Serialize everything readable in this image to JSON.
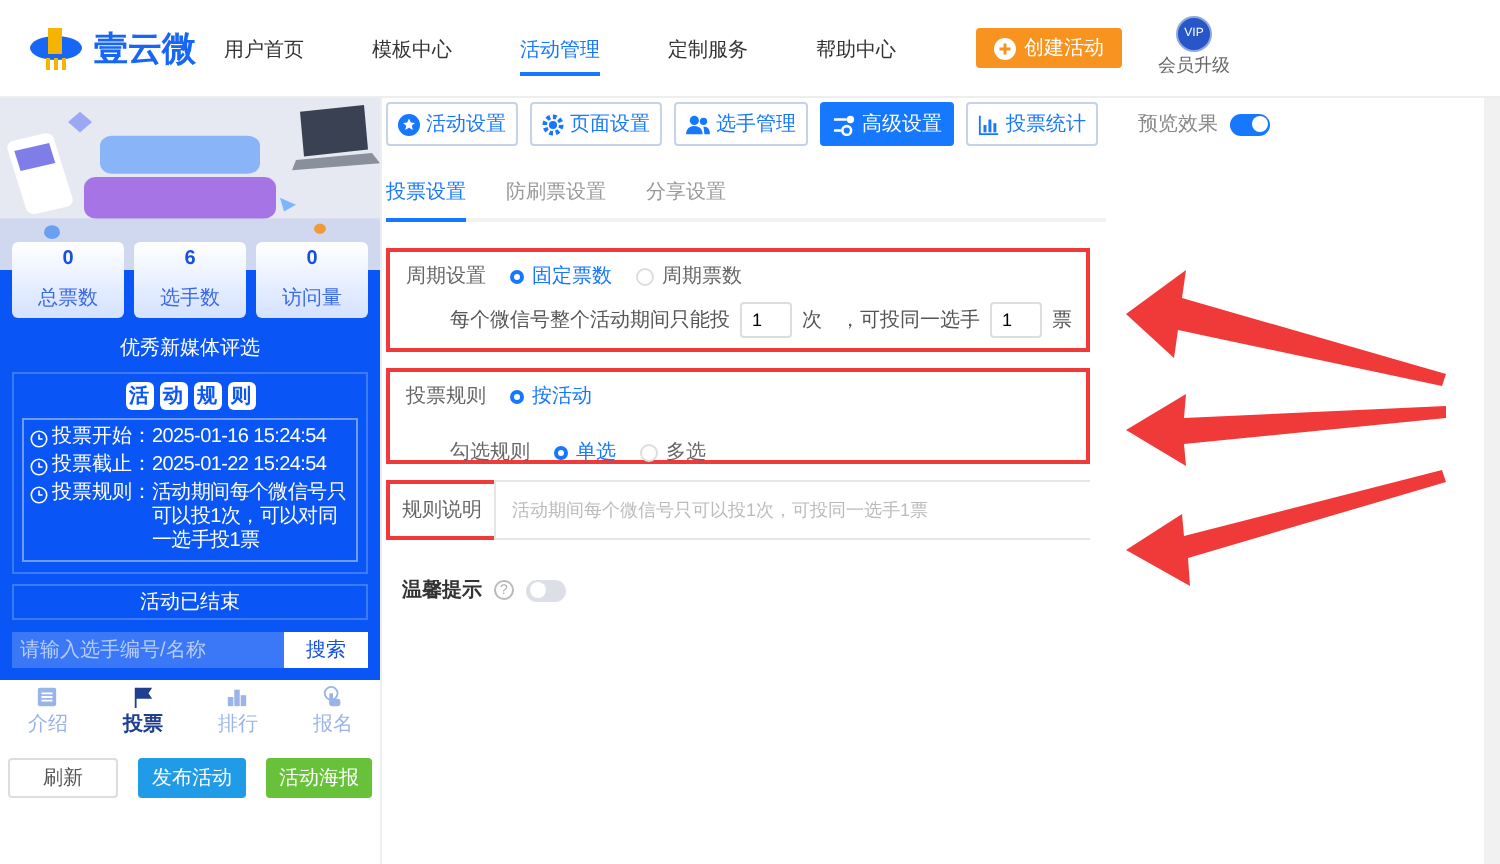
{
  "header": {
    "logo": "壹云微",
    "nav": [
      {
        "label": "用户首页",
        "selected": false
      },
      {
        "label": "模板中心",
        "selected": false
      },
      {
        "label": "活动管理",
        "selected": true
      },
      {
        "label": "定制服务",
        "selected": false
      },
      {
        "label": "帮助中心",
        "selected": false
      }
    ],
    "create_button": "创建活动",
    "vip_badge": "VIP",
    "vip_label": "会员升级"
  },
  "sidebar": {
    "banner": {
      "kind": "picture"
    },
    "stats": [
      {
        "value": "0",
        "label": "总票数"
      },
      {
        "value": "6",
        "label": "选手数"
      },
      {
        "value": "0",
        "label": "访问量"
      }
    ],
    "title": "优秀新媒体评选",
    "rules_heading": [
      "活",
      "动",
      "规",
      "则"
    ],
    "rules": [
      {
        "label": "投票开始：",
        "text": "2025-01-16 15:24:54"
      },
      {
        "label": "投票截止：",
        "text": "2025-01-22 15:24:54"
      },
      {
        "label": "投票规则：",
        "text": "活动期间每个微信号只可以投1次，可以对同一选手投1票"
      }
    ],
    "status": "活动已结束",
    "search": {
      "placeholder": "请输入选手编号/名称",
      "button": "搜索"
    },
    "bottom_nav": [
      {
        "label": "介绍",
        "kind": "list",
        "selected": false
      },
      {
        "label": "投票",
        "kind": "flag",
        "selected": true
      },
      {
        "label": "排行",
        "kind": "chart",
        "selected": false
      },
      {
        "label": "报名",
        "kind": "hand",
        "selected": false
      }
    ],
    "buttons": [
      {
        "label": "刷新",
        "kind": "plain"
      },
      {
        "label": "发布活动",
        "kind": "primary"
      },
      {
        "label": "活动海报",
        "kind": "success"
      }
    ]
  },
  "toolbar": {
    "tabs": [
      {
        "label": "活动设置",
        "kind": "star",
        "selected": false
      },
      {
        "label": "页面设置",
        "kind": "gear",
        "selected": false
      },
      {
        "label": "选手管理",
        "kind": "people",
        "selected": false
      },
      {
        "label": "高级设置",
        "kind": "sliders",
        "selected": true
      },
      {
        "label": "投票统计",
        "kind": "chart",
        "selected": false
      }
    ],
    "preview": {
      "label": "预览效果",
      "on": true
    }
  },
  "sub_tabs": [
    {
      "label": "投票设置",
      "selected": true
    },
    {
      "label": "防刷票设置",
      "selected": false
    },
    {
      "label": "分享设置",
      "selected": false
    }
  ],
  "cycle": {
    "label": "周期设置",
    "options": [
      {
        "label": "固定票数",
        "selected": true
      },
      {
        "label": "周期票数",
        "selected": false
      }
    ],
    "sentence": {
      "before": "每个微信号整个活动期间只能投",
      "times_value": "1",
      "times_unit": "次",
      "middle": "，可投同一选手",
      "votes_value": "1",
      "votes_unit": "票"
    }
  },
  "vote_rule": {
    "label": "投票规则",
    "options": [
      {
        "label": "按活动",
        "selected": true
      }
    ],
    "check_label": "勾选规则",
    "check_options": [
      {
        "label": "单选",
        "selected": true
      },
      {
        "label": "多选",
        "selected": false
      }
    ]
  },
  "rule_note": {
    "label": "规则说明",
    "placeholder": "活动期间每个微信号只可以投1次，可投同一选手1票"
  },
  "tip": {
    "label": "温馨提示",
    "help": "?",
    "on": false
  }
}
